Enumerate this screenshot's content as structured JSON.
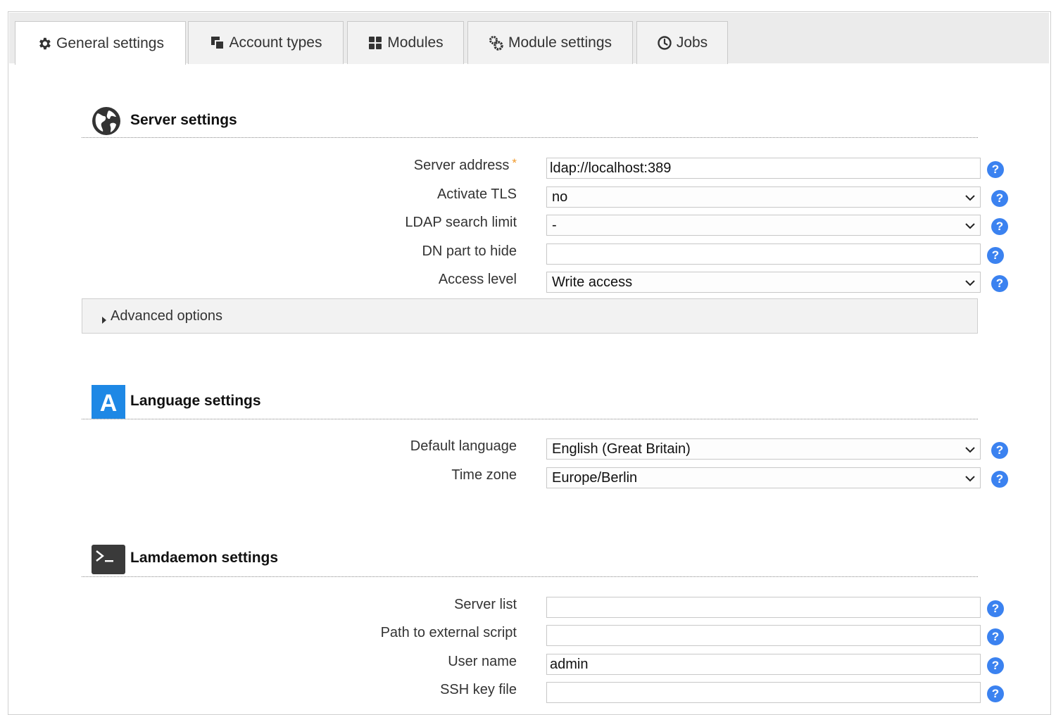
{
  "tabs": [
    {
      "label": "General settings",
      "icon": "gear-icon",
      "active": true
    },
    {
      "label": "Account types",
      "icon": "copy-icon"
    },
    {
      "label": "Modules",
      "icon": "grid-icon"
    },
    {
      "label": "Module settings",
      "icon": "gears-icon"
    },
    {
      "label": "Jobs",
      "icon": "clock-icon"
    }
  ],
  "server": {
    "title": "Server settings",
    "icon": "globe-icon",
    "fields": {
      "address": {
        "label": "Server address",
        "required_mark": "*",
        "value": "ldap://localhost:389"
      },
      "tls": {
        "label": "Activate TLS",
        "value": "no"
      },
      "limit": {
        "label": "LDAP search limit",
        "value": "-"
      },
      "dn": {
        "label": "DN part to hide",
        "value": ""
      },
      "access": {
        "label": "Access level",
        "value": "Write access"
      }
    },
    "advanced_label": "Advanced options"
  },
  "language": {
    "title": "Language settings",
    "icon": "language-a-icon",
    "icon_letter": "A",
    "fields": {
      "lang": {
        "label": "Default language",
        "value": "English (Great Britain)"
      },
      "tz": {
        "label": "Time zone",
        "value": "Europe/Berlin"
      }
    }
  },
  "lamdaemon": {
    "title": "Lamdaemon settings",
    "icon": "terminal-icon",
    "fields": {
      "servers": {
        "label": "Server list",
        "value": ""
      },
      "script": {
        "label": "Path to external script",
        "value": ""
      },
      "user": {
        "label": "User name",
        "value": "admin"
      },
      "sshkey": {
        "label": "SSH key file",
        "value": ""
      }
    }
  },
  "help_glyph": "?",
  "colors": {
    "help": "#3b82f0",
    "required": "#f19a2b",
    "lang_icon": "#1e88e5",
    "terminal_icon": "#3a3a3a"
  }
}
